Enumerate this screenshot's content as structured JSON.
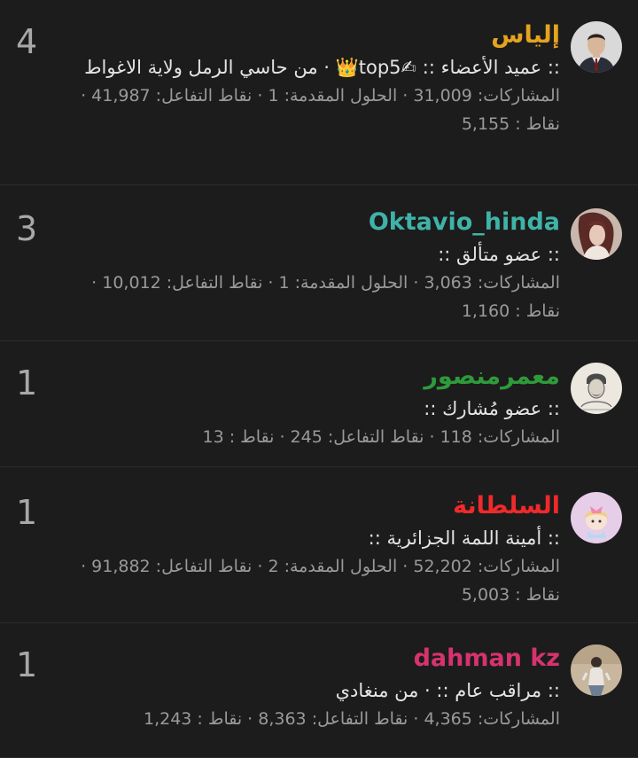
{
  "colors": {
    "background": "#1c1c1c",
    "separator": "#2c2c2c",
    "stats_text": "#9a9a9a",
    "score_text": "#a8a8a8"
  },
  "members": [
    {
      "username": "إلياس",
      "username_color": "#e4a320",
      "title": ":: عميد الأعضاء :: ✍top5👑 · من حاسي الرمل ولاية الاغواط",
      "stats": "المشاركات: 31,009 · الحلول المقدمة: 1 · نقاط التفاعل: 41,987 · نقاط : 5,155",
      "score": "4",
      "avatar_icon": "man-portrait-avatar"
    },
    {
      "username": "Oktavio_hinda",
      "username_color": "#3fb3a8",
      "title": ":: عضو متألق ::",
      "stats": "المشاركات: 3,063 · الحلول المقدمة: 1 · نقاط التفاعل: 10,012 · نقاط : 1,160",
      "score": "3",
      "avatar_icon": "woman-portrait-avatar"
    },
    {
      "username": "معمرمنصور",
      "username_color": "#2e9a3a",
      "title": ":: عضو مُشارك ::",
      "stats": "المشاركات: 118 · نقاط التفاعل: 245 · نقاط : 13",
      "score": "1",
      "avatar_icon": "sketch-portrait-avatar"
    },
    {
      "username": "السلطانة",
      "username_color": "#f02a2a",
      "title": ":: أمينة اللمة الجزائرية ::",
      "stats": "المشاركات: 52,202 · الحلول المقدمة: 2 · نقاط التفاعل: 91,882 · نقاط : 5,003",
      "score": "1",
      "avatar_icon": "cartoon-girl-avatar"
    },
    {
      "username": "dahman kz",
      "username_color": "#d6336e",
      "title": ":: مراقب عام :: · من منغادي",
      "stats": "المشاركات: 4,365 · نقاط التفاعل: 8,363 · نقاط : 1,243",
      "score": "1",
      "avatar_icon": "person-photo-avatar"
    }
  ]
}
